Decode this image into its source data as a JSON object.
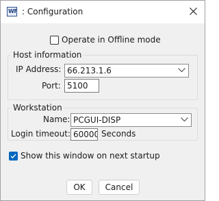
{
  "window": {
    "app_icon_text": "WF",
    "title": ": Configuration"
  },
  "offline": {
    "label": "Operate in Offline mode",
    "checked": false
  },
  "host": {
    "group_label": "Host information",
    "ip_label": "IP Address:",
    "ip_value": "66.213.1.6",
    "port_label": "Port:",
    "port_value": "5100"
  },
  "workstation": {
    "group_label": "Workstation",
    "name_label": "Name:",
    "name_value": "PCGUI-DISP",
    "timeout_label": "Login timeout:",
    "timeout_value": "60000",
    "timeout_unit": "Seconds"
  },
  "startup": {
    "label": "Show this window on next startup",
    "checked": true
  },
  "buttons": {
    "ok": "OK",
    "cancel": "Cancel"
  },
  "colors": {
    "accent": "#0067c0"
  },
  "icons": [
    "app-icon",
    "close-icon",
    "chevron-down-icon",
    "checkmark-icon"
  ]
}
